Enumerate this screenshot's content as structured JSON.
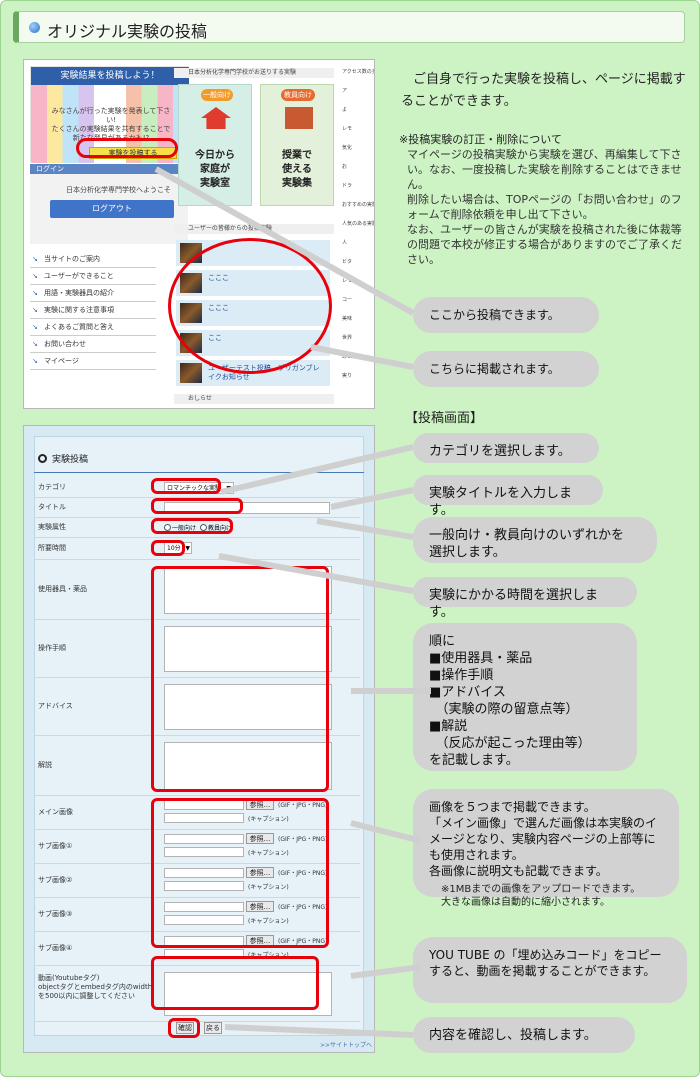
{
  "header": {
    "title": "オリジナル実験の投稿"
  },
  "top_shot": {
    "banner": "実験結果を投稿しよう！",
    "banner_text": "みなさんが行った実験を発表して下さい!\nたくさんの実験結果を共有することで\n新たな発見があるかも!?",
    "post_button": "実験を投稿する",
    "login_bar": "ログイン",
    "welcome": "日本分析化学専門学校へようこそ",
    "logout": "ログアウト",
    "nav": [
      "当サイトのご案内",
      "ユーザーができること",
      "用語・実験器具の紹介",
      "実験に関する注意事項",
      "よくあるご質問と答え",
      "お問い合わせ",
      "マイページ"
    ],
    "top_bar": "日本分析化学専門学校がお送りする実験",
    "card1_tag": "一般向け",
    "card1_text": "今日から\n家庭が\n実験室",
    "card2_tag": "教員向け",
    "card2_text": "授業で\n使える\n実験集",
    "posts_bar": "ユーザーの皆様からの投稿実験",
    "posts": [
      "",
      "こここ",
      "こここ",
      "ここ",
      "ユーザーテスト投稿　ブリガンブレイクお知らせ"
    ],
    "news_bar": "おしらせ",
    "right_col": [
      "アクセス数の多い実験",
      "ア",
      "よ",
      "レモ",
      "気化",
      "お",
      "ドラ",
      "おすすめの実験",
      "人気のある実験",
      "人",
      "ビタ",
      "レモ",
      "コー",
      "美味",
      "世界",
      "のビーカ",
      "実り"
    ]
  },
  "intro": {
    "lead": "ご自身で行った実験を投稿し、ページに掲載することができます。",
    "note_title": "※投稿実験の訂正・削除について",
    "note_body": "マイページの投稿実験から実験を選び、再編集して下さい。なお、一度投稿した実験を削除することはできません。\n削除したい場合は、TOPページの「お問い合わせ」のフォームで削除依頼を申し出て下さい。\nなお、ユーザーの皆さんが実験を投稿された後に体裁等の問題で本校が修正する場合がありますのでご了承ください。"
  },
  "callouts_top": [
    "ここから投稿できます。",
    "こちらに掲載されます。"
  ],
  "section2_title": "【投稿画面】",
  "form": {
    "title": "実験投稿",
    "fields": [
      {
        "label": "カテゴリ",
        "value": "ロマンチックな実験"
      },
      {
        "label": "タイトル",
        "value": ""
      },
      {
        "label": "実験属性",
        "value": ""
      },
      {
        "label": "所要時間",
        "value": "10分"
      },
      {
        "label": "使用器具・薬品",
        "value": ""
      },
      {
        "label": "操作手順",
        "value": ""
      },
      {
        "label": "アドバイス",
        "value": ""
      },
      {
        "label": "解説",
        "value": ""
      },
      {
        "label": "メイン画像",
        "value": ""
      },
      {
        "label": "サブ画像①",
        "value": ""
      },
      {
        "label": "サブ画像②",
        "value": ""
      },
      {
        "label": "サブ画像③",
        "value": ""
      },
      {
        "label": "サブ画像④",
        "value": ""
      },
      {
        "label": "動画(Youtubeタグ)\nobjectタグとembedタグ内のwidthを500以内に調整してください",
        "value": ""
      }
    ],
    "radio1": "一般向け",
    "radio2": "教員向け",
    "browse": "参照...",
    "formats": "(GIF・JPG・PNG)",
    "caption": "(キャプション)",
    "confirm": "確認",
    "back": "戻る",
    "footer_link": ">>サイトトップへ"
  },
  "callouts_form": [
    "カテゴリを選択します。",
    "実験タイトルを入力します。",
    "一般向け・教員向けのいずれかを\n選択します。",
    "実験にかかる時間を選択します。",
    "順に\n■使用器具・薬品\n■操作手順\n■アドバイス\n　（実験の際の留意点等）\n■解説\n　（反応が起こった理由等）\nを記載します。",
    "画像を５つまで掲載できます。\n「メイン画像」で選んだ画像は本実験のイメージとなり、実験内容ページの上部等にも使用されます。\n各画像に説明文も記載できます。",
    "※1MBまでの画像をアップロードできます。\n大きな画像は自動的に縮小されます。",
    "YOU TUBE の「埋め込みコード」をコピーすると、動画を掲載することができます。",
    "内容を確認し、投稿します。"
  ]
}
